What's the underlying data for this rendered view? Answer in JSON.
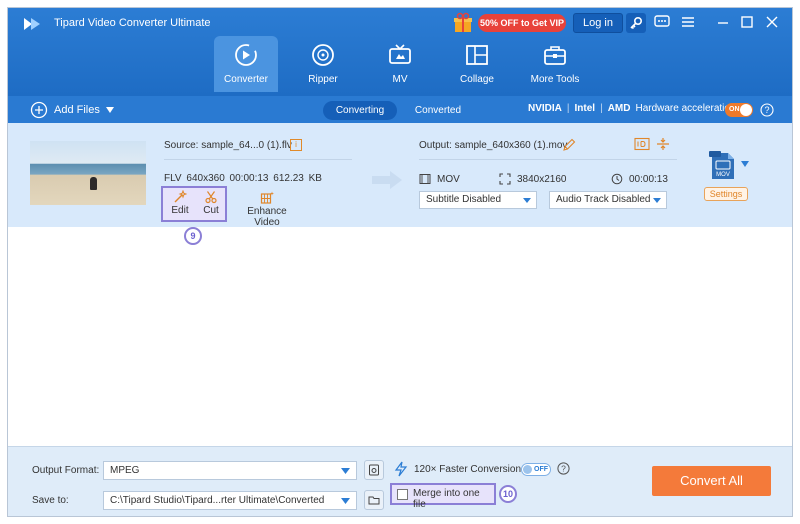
{
  "titlebar": {
    "app_title": "Tipard Video Converter Ultimate",
    "vip_badge": "50% OFF to Get VIP",
    "login_label": "Log in"
  },
  "nav": {
    "items": [
      {
        "label": "Converter",
        "icon": "converter-icon"
      },
      {
        "label": "Ripper",
        "icon": "disc-icon"
      },
      {
        "label": "MV",
        "icon": "tv-icon"
      },
      {
        "label": "Collage",
        "icon": "collage-icon"
      },
      {
        "label": "More Tools",
        "icon": "toolbox-icon"
      }
    ],
    "active": "Converter"
  },
  "toolbar": {
    "add_files_label": "Add Files",
    "tab_converting": "Converting",
    "tab_converted": "Converted",
    "hw_nvidia": "NVIDIA",
    "hw_intel": "Intel",
    "hw_amd": "AMD",
    "hw_label": "Hardware acceleration",
    "hw_toggle": "ON"
  },
  "file": {
    "source_name": "Source: sample_64...0 (1).flv",
    "src_format": "FLV",
    "src_resolution": "640x360",
    "src_duration": "00:00:13",
    "src_size": "612.23 KB",
    "edit_label": "Edit",
    "cut_label": "Cut",
    "enhance_label": "Enhance Video",
    "output_name": "Output: sample_640x360 (1).mov",
    "out_format": "MOV",
    "out_resolution": "3840x2160",
    "out_duration": "00:00:13",
    "subtitle": "Subtitle Disabled",
    "audio_track": "Audio Track Disabled",
    "format_badge": "MOV",
    "settings_label": "Settings",
    "step_edit": "9"
  },
  "bottom": {
    "output_format_label": "Output Format:",
    "output_format_value": "MPEG",
    "save_to_label": "Save to:",
    "save_to_value": "C:\\Tipard Studio\\Tipard...rter Ultimate\\Converted",
    "faster_label": "120× Faster Conversion",
    "faster_toggle": "OFF",
    "merge_label": "Merge into one file",
    "step_merge": "10",
    "convert_all_label": "Convert All"
  },
  "colors": {
    "primary": "#2c7dd4",
    "accent": "#f47a3a",
    "vip": "#e8423a",
    "highlight": "#8b7fd6"
  }
}
